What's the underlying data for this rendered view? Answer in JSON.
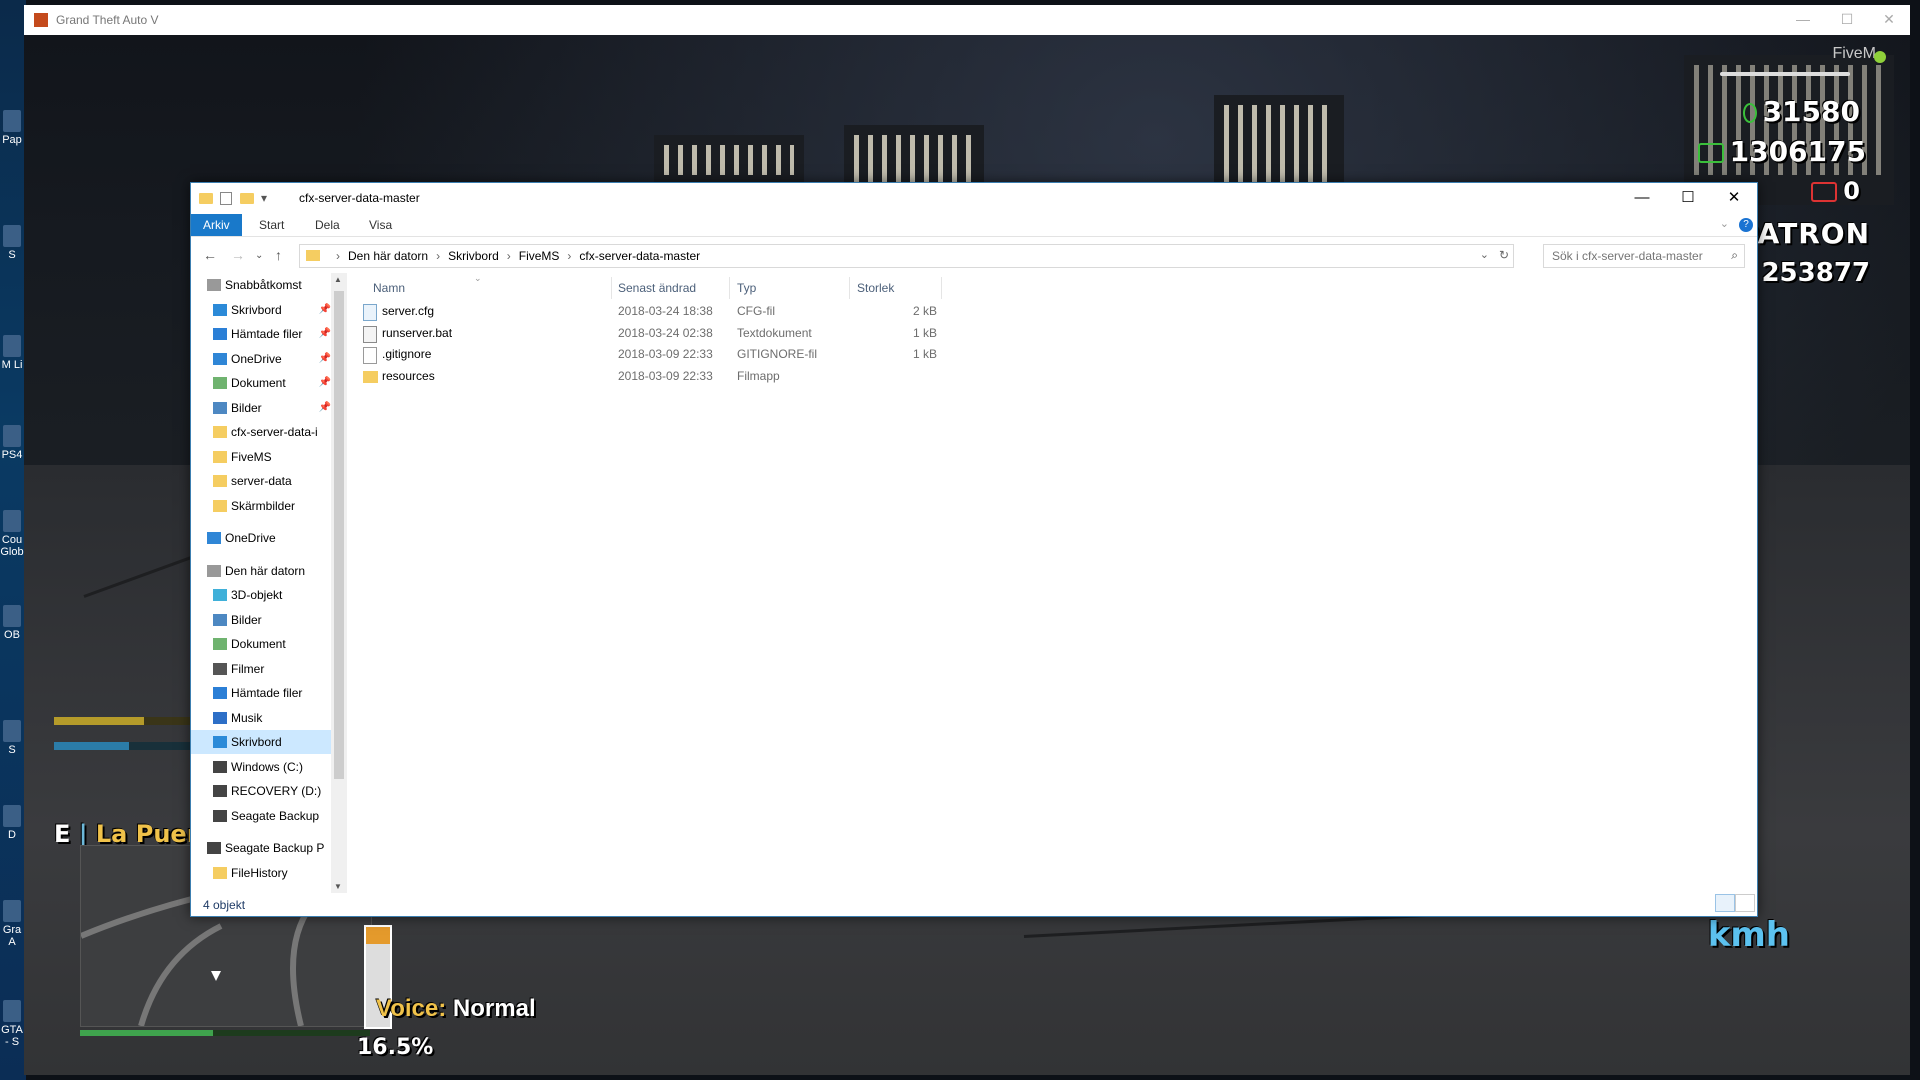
{
  "game_window": {
    "title": "Grand Theft Auto V",
    "controls": {
      "minimize": "—",
      "maximize": "☐",
      "close": "✕"
    }
  },
  "desktop_icons": [
    {
      "label": "Pap",
      "icon": "document-icon"
    },
    {
      "label": "S",
      "icon": "app-icon"
    },
    {
      "label": "M Li",
      "icon": "app-icon"
    },
    {
      "label": "PS4",
      "icon": "app-icon"
    },
    {
      "label": "Cou Glob",
      "icon": "game-icon"
    },
    {
      "label": "OB",
      "icon": "obs-icon"
    },
    {
      "label": "S",
      "icon": "app-icon"
    },
    {
      "label": "D",
      "icon": "app-icon"
    },
    {
      "label": "Gra A",
      "icon": "game-icon"
    },
    {
      "label": "GTA - S",
      "icon": "game-icon"
    }
  ],
  "hud": {
    "fivem_label": "FiveM",
    "cash": "31580",
    "bank": "1306175",
    "dirty_money": "0",
    "job": "PATRON",
    "player_id": "253877",
    "street": {
      "direction": "E",
      "separator": "|",
      "name": "La Puerta"
    },
    "voice": {
      "label": "Voice:",
      "value": "Normal"
    },
    "fuel_percent_text": "16.5%",
    "fuel_level": 0.165,
    "speed_unit": "kmh",
    "health_level": 0.46,
    "armor_level": 0.6,
    "stamina_level": 0.5
  },
  "explorer": {
    "title": "cfx-server-data-master",
    "window_controls": {
      "minimize": "—",
      "maximize": "☐",
      "close": "✕"
    },
    "ribbon_tabs": [
      "Arkiv",
      "Start",
      "Dela",
      "Visa"
    ],
    "breadcrumbs": [
      "Den här datorn",
      "Skrivbord",
      "FiveMS",
      "cfx-server-data-master"
    ],
    "search_placeholder": "Sök i cfx-server-data-master",
    "navigation": {
      "quick_access": {
        "label": "Snabbåtkomst",
        "items": [
          {
            "label": "Skrivbord",
            "icon": "desktop-icon",
            "pinned": true
          },
          {
            "label": "Hämtade filer",
            "icon": "download-icon",
            "pinned": true
          },
          {
            "label": "OneDrive",
            "icon": "onedrive-icon",
            "pinned": true
          },
          {
            "label": "Dokument",
            "icon": "documents-icon",
            "pinned": true
          },
          {
            "label": "Bilder",
            "icon": "pictures-icon",
            "pinned": true
          },
          {
            "label": "cfx-server-data-i",
            "icon": "folder-icon",
            "pinned": false
          },
          {
            "label": "FiveMS",
            "icon": "folder-icon",
            "pinned": false
          },
          {
            "label": "server-data",
            "icon": "folder-icon",
            "pinned": false
          },
          {
            "label": "Skärmbilder",
            "icon": "folder-icon",
            "pinned": false
          }
        ]
      },
      "onedrive": "OneDrive",
      "this_pc": {
        "label": "Den här datorn",
        "items": [
          {
            "label": "3D-objekt",
            "icon": "3d-objects-icon"
          },
          {
            "label": "Bilder",
            "icon": "pictures-icon"
          },
          {
            "label": "Dokument",
            "icon": "documents-icon"
          },
          {
            "label": "Filmer",
            "icon": "videos-icon"
          },
          {
            "label": "Hämtade filer",
            "icon": "download-icon"
          },
          {
            "label": "Musik",
            "icon": "music-icon"
          },
          {
            "label": "Skrivbord",
            "icon": "desktop-icon"
          },
          {
            "label": "Windows (C:)",
            "icon": "drive-icon"
          },
          {
            "label": "RECOVERY (D:)",
            "icon": "drive-icon"
          },
          {
            "label": "Seagate Backup",
            "icon": "drive-icon"
          }
        ]
      },
      "extra": [
        {
          "label": "Seagate Backup P",
          "icon": "drive-icon"
        },
        {
          "label": "FileHistory",
          "icon": "folder-icon"
        }
      ]
    },
    "columns": [
      "Namn",
      "Senast ändrad",
      "Typ",
      "Storlek"
    ],
    "files": [
      {
        "name": "server.cfg",
        "modified": "2018-03-24 18:38",
        "type": "CFG-fil",
        "size": "2 kB",
        "icon": "cfg"
      },
      {
        "name": "runserver.bat",
        "modified": "2018-03-24 02:38",
        "type": "Textdokument",
        "size": "1 kB",
        "icon": "bat"
      },
      {
        "name": ".gitignore",
        "modified": "2018-03-09 22:33",
        "type": "GITIGNORE-fil",
        "size": "1 kB",
        "icon": "file"
      },
      {
        "name": "resources",
        "modified": "2018-03-09 22:33",
        "type": "Filmapp",
        "size": "",
        "icon": "folder"
      }
    ],
    "status": "4 objekt"
  }
}
